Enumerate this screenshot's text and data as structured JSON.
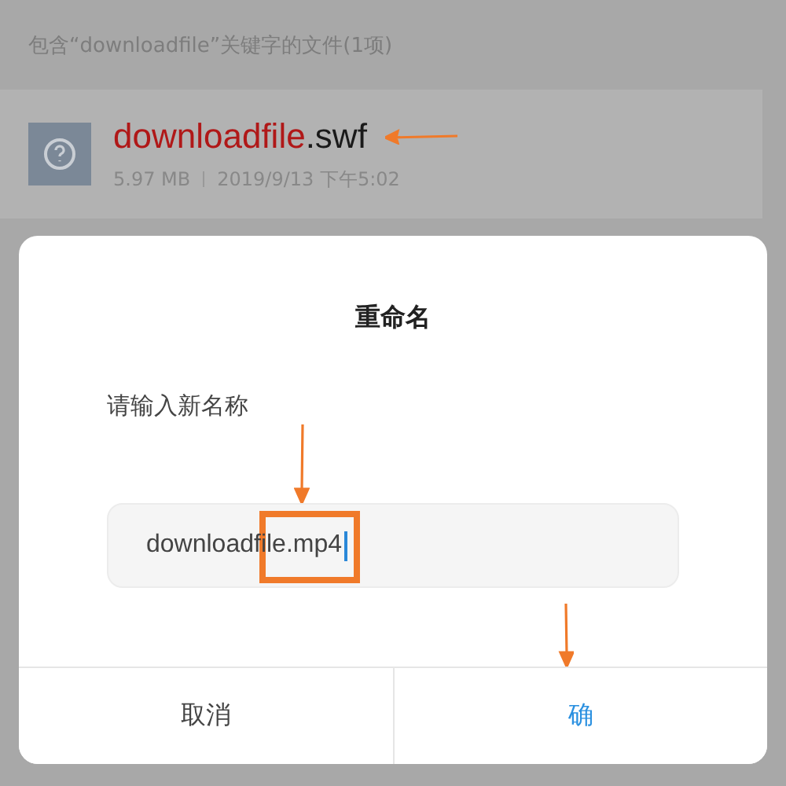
{
  "search_header": "包含“downloadfile”关键字的文件(1项)",
  "file": {
    "name_match": "downloadfile",
    "name_rest": ".swf",
    "size": "5.97 MB",
    "date": "2019/9/13 下午5:02"
  },
  "dialog": {
    "title": "重命名",
    "label": "请输入新名称",
    "value": "downloadfile.mp4",
    "buttons": [
      {
        "label": "取消",
        "kind": "cancel"
      },
      {
        "label": "确",
        "kind": "confirm"
      }
    ]
  }
}
